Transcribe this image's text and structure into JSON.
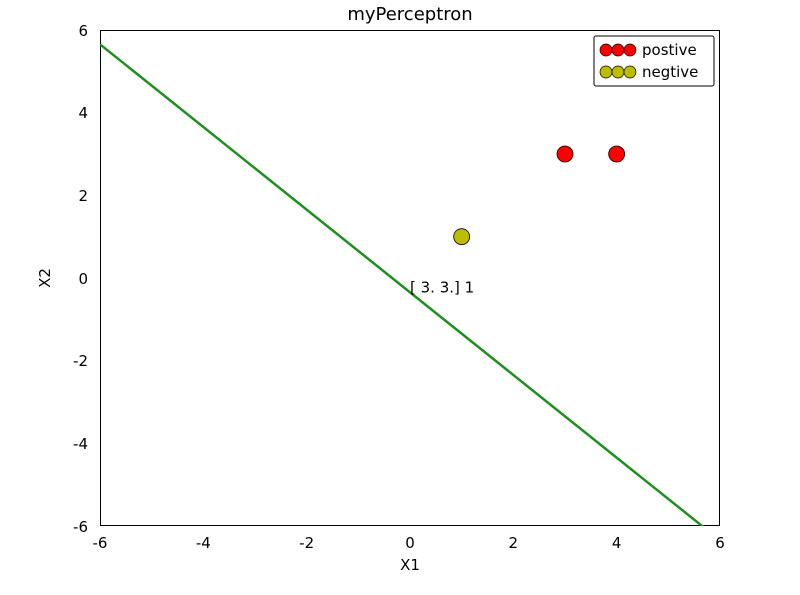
{
  "chart_data": {
    "type": "scatter",
    "title": "myPerceptron",
    "xlabel": "X1",
    "ylabel": "X2",
    "xlim": [
      -6,
      6
    ],
    "ylim": [
      -6,
      6
    ],
    "xticks": [
      -6,
      -4,
      -2,
      0,
      2,
      4,
      6
    ],
    "yticks": [
      -6,
      -4,
      -2,
      0,
      2,
      4,
      6
    ],
    "series": [
      {
        "name": "postive",
        "color": "#ff0000",
        "points": [
          [
            3,
            3
          ],
          [
            4,
            3
          ]
        ]
      },
      {
        "name": "negtive",
        "color": "#bdbd00",
        "points": [
          [
            1,
            1
          ]
        ]
      }
    ],
    "line": {
      "color": "#1f8f1f",
      "x": [
        -6,
        6
      ],
      "y": [
        5.654,
        -6.346
      ]
    },
    "annotation": {
      "text": "[ 3.  3.]  1",
      "x": 0,
      "y": -0.35
    },
    "legend": {
      "items": [
        "postive",
        "negtive"
      ],
      "loc": "upper right"
    },
    "tick_labels": {
      "x": [
        "-6",
        "-4",
        "-2",
        "0",
        "2",
        "4",
        "6"
      ],
      "y": [
        "-6",
        "-4",
        "-2",
        "0",
        "2",
        "4",
        "6"
      ]
    }
  }
}
